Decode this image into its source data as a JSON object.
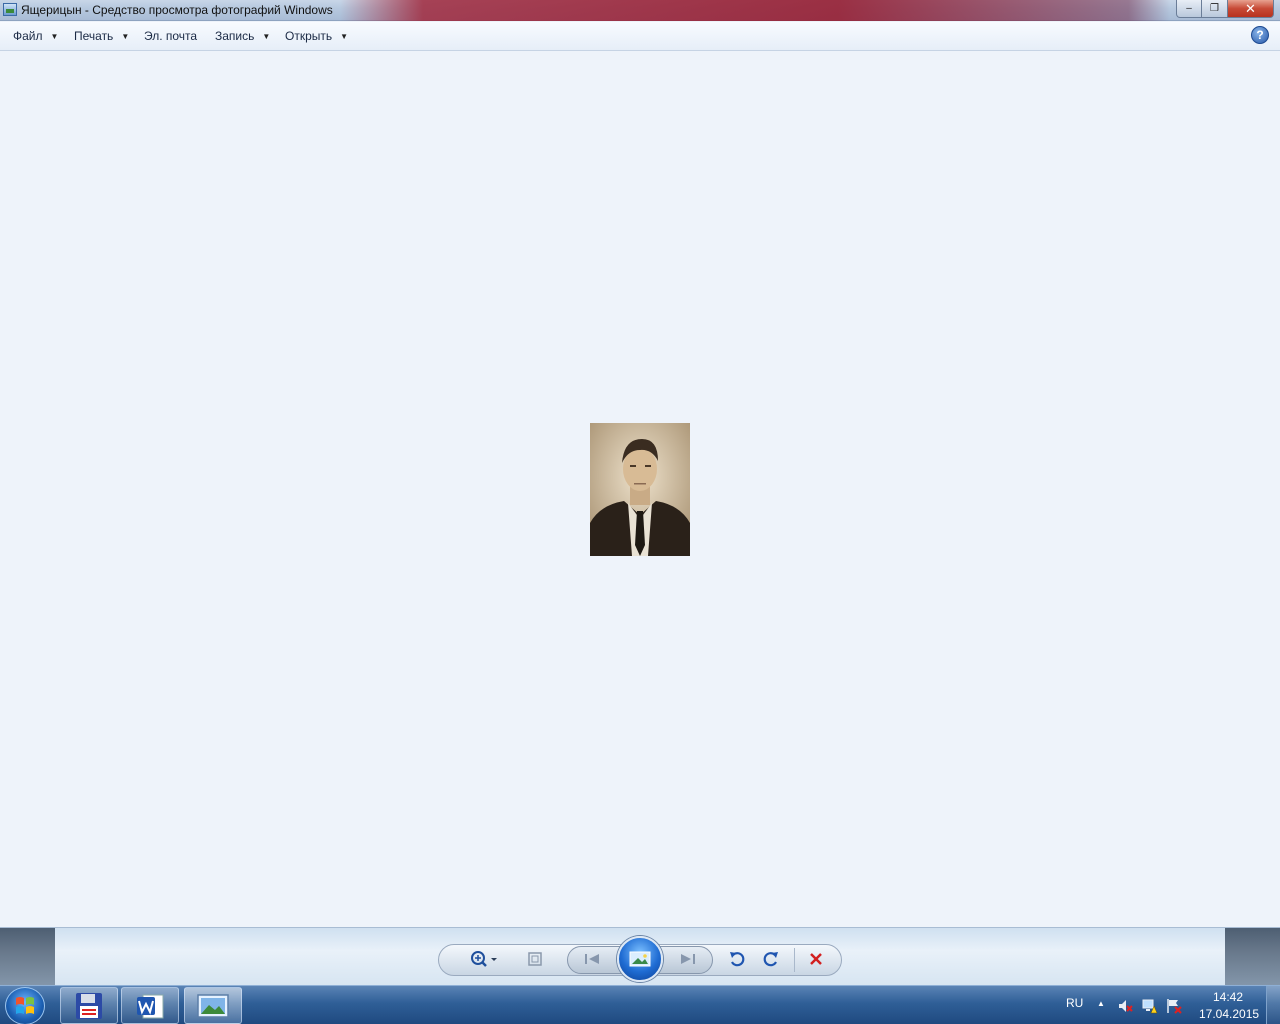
{
  "window": {
    "title": "Ящерицын - Средство просмотра фотографий Windows",
    "minimize_glyph": "–",
    "maximize_glyph": "❐",
    "close_glyph": "✕"
  },
  "menu": {
    "file": "Файл",
    "print": "Печать",
    "email": "Эл. почта",
    "burn": "Запись",
    "open": "Открыть",
    "help_glyph": "?"
  },
  "taskbar": {
    "language": "RU",
    "tray_expand_glyph": "▲",
    "time": "14:42",
    "date": "17.04.2015",
    "apps": [
      "save-app",
      "word-app",
      "photo-viewer-app"
    ]
  },
  "controls": {
    "icons": [
      "zoom-icon",
      "fit-window-icon",
      "previous-icon",
      "slideshow-icon",
      "next-icon",
      "rotate-left-icon",
      "rotate-right-icon",
      "delete-icon"
    ]
  },
  "colors": {
    "accent": "#1f6cd3",
    "delete": "#d21f1f",
    "viewer_bg": "#eef3fa"
  }
}
